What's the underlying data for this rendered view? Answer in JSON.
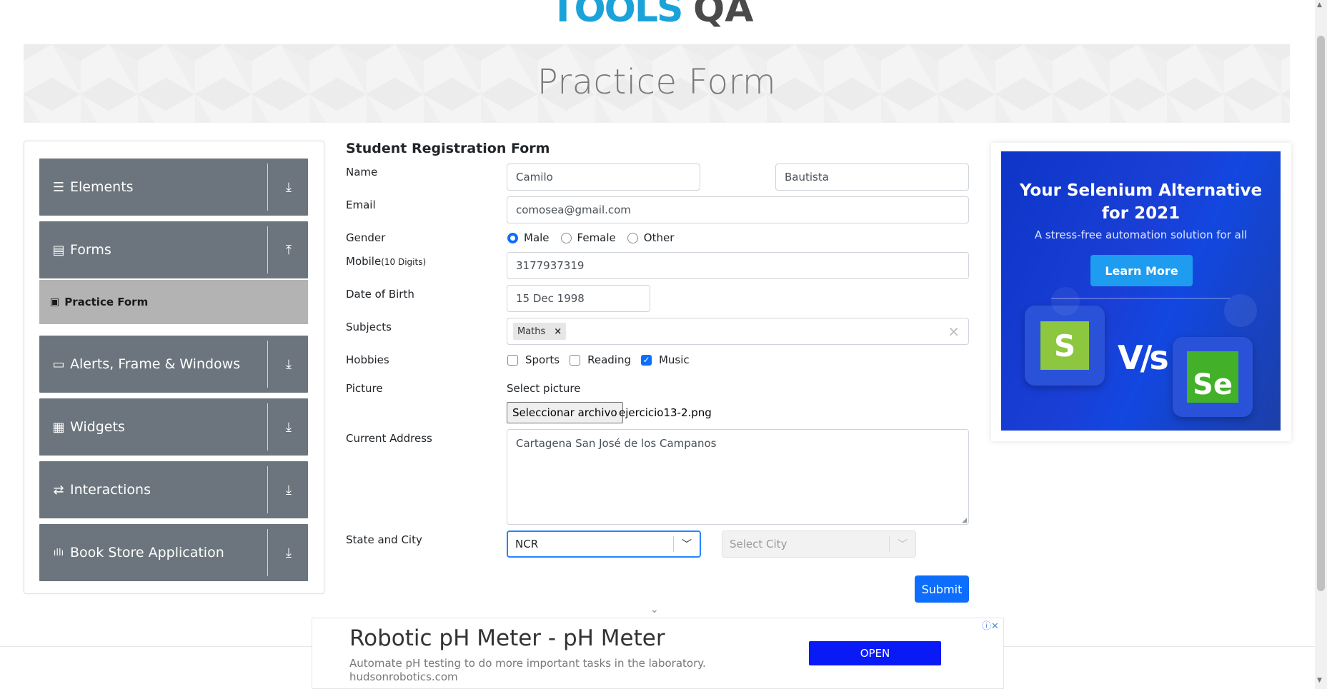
{
  "logo": {
    "text_a": "TOOLS",
    "text_b": "QA"
  },
  "banner": {
    "title": "Practice Form"
  },
  "sidebar": {
    "groups": [
      {
        "label": "Elements",
        "icon": "☰"
      },
      {
        "label": "Forms",
        "icon": "▤"
      },
      {
        "label": "Alerts, Frame & Windows",
        "icon": "▭"
      },
      {
        "label": "Widgets",
        "icon": "▦"
      },
      {
        "label": "Interactions",
        "icon": "⇄"
      },
      {
        "label": "Book Store Application",
        "icon": "ıllı"
      }
    ],
    "arrows": {
      "down": "⤓",
      "up": "⤒"
    },
    "active_item": {
      "label": "Practice Form",
      "icon": "▣"
    }
  },
  "form": {
    "title": "Student Registration Form",
    "labels": {
      "name": "Name",
      "email": "Email",
      "gender": "Gender",
      "mobile": "Mobile",
      "mobile_hint": "(10 Digits)",
      "dob": "Date of Birth",
      "subjects": "Subjects",
      "hobbies": "Hobbies",
      "picture": "Picture",
      "address": "Current Address",
      "state_city": "State and City"
    },
    "first_name": "Camilo",
    "last_name": "Bautista",
    "email": "comosea@gmail.com",
    "gender_options": [
      "Male",
      "Female",
      "Other"
    ],
    "gender_selected": "Male",
    "mobile": "3177937319",
    "dob": "15 Dec 1998",
    "subjects": [
      "Maths"
    ],
    "subject_remove": "×",
    "subjects_clear": "×",
    "hobbies": [
      {
        "label": "Sports",
        "checked": false
      },
      {
        "label": "Reading",
        "checked": false
      },
      {
        "label": "Music",
        "checked": true
      }
    ],
    "picture_caption": "Select picture",
    "file_button": "Seleccionar archivo",
    "file_name": "ejercicio13-2.png",
    "address": "Cartagena San José de los Campanos",
    "state": "NCR",
    "city_placeholder": "Select City",
    "submit": "Submit"
  },
  "ad_right": {
    "headline_1": "Your Selenium Alternative",
    "headline_2": "for 2021",
    "subtitle": "A stress-free automation solution for all",
    "button": "Learn More",
    "vs": "V/s",
    "tile_left": "S",
    "tile_right": "Se"
  },
  "ad_bottom": {
    "title": "Robotic pH Meter - pH Meter",
    "description": "Automate pH testing to do more important tasks in the laboratory.",
    "url": "hudsonrobotics.com",
    "button": "OPEN",
    "icons": "ⓘ✕"
  },
  "chevron": "⌄"
}
